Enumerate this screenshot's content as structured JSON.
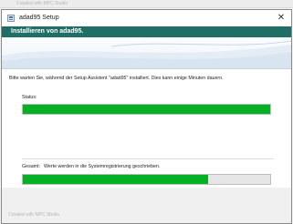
{
  "backdrop": {
    "text": "Created with MPC Studio"
  },
  "window": {
    "title": "adad95 Setup",
    "close_glyph": "✕"
  },
  "banner": {
    "title": "Installieren von adad95."
  },
  "content": {
    "message": "Bitte warten Sie, während der Setup Assistent \"adad95\" installiert. Dies kann einige Minuten dauern.",
    "status_label": "Status:",
    "progress_main": 1.0,
    "detail_label": "Gesamt:",
    "detail_text": "Werte werden in die Systemregistrierung geschrieben.",
    "progress_total": 0.75
  },
  "footer": {
    "text": "Created with MPC Studio"
  },
  "colors": {
    "progress": "#06b025",
    "banner_head": "#1f6f66"
  },
  "icons": {
    "app": "installer-icon",
    "close": "close-icon"
  }
}
